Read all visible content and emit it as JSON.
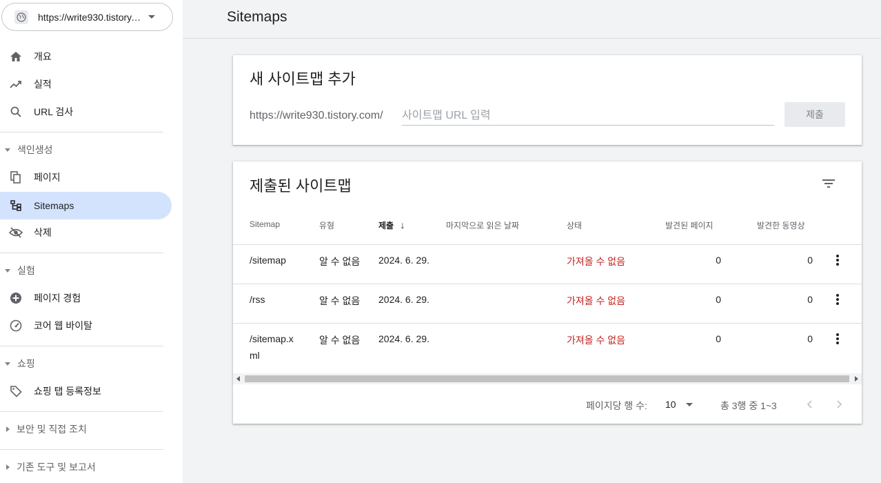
{
  "property": {
    "url": "https://write930.tistory.com/"
  },
  "sidebar": {
    "items": [
      {
        "label": "개요"
      },
      {
        "label": "실적"
      },
      {
        "label": "URL 검사"
      }
    ],
    "sections": [
      {
        "label": "색인생성",
        "items": [
          {
            "label": "페이지"
          },
          {
            "label": "Sitemaps"
          },
          {
            "label": "삭제"
          }
        ]
      },
      {
        "label": "실험",
        "items": [
          {
            "label": "페이지 경험"
          },
          {
            "label": "코어 웹 바이탈"
          }
        ]
      },
      {
        "label": "쇼핑",
        "items": [
          {
            "label": "쇼핑 탭 등록정보"
          }
        ]
      },
      {
        "label": "보안 및 직접 조치"
      },
      {
        "label": "기존 도구 및 보고서"
      }
    ]
  },
  "header": {
    "title": "Sitemaps"
  },
  "add_card": {
    "title": "새 사이트맵 추가",
    "prefix": "https://write930.tistory.com/",
    "placeholder": "사이트맵 URL 입력",
    "value": "",
    "submit_label": "제출"
  },
  "submitted_card": {
    "title": "제출된 사이트맵",
    "columns": [
      "Sitemap",
      "유형",
      "제출",
      "마지막으로 읽은 날짜",
      "상태",
      "발견된 페이지",
      "발견한 동영상"
    ],
    "sort_arrow": "↓",
    "rows": [
      {
        "sitemap": "/sitemap",
        "sitemap2": "",
        "type": "알 수 없음",
        "submitted": "2024. 6. 29.",
        "last_read": "",
        "status": "가져올 수 없음",
        "pages": "0",
        "videos": "0"
      },
      {
        "sitemap": "/rss",
        "sitemap2": "",
        "type": "알 수 없음",
        "submitted": "2024. 6. 29.",
        "last_read": "",
        "status": "가져올 수 없음",
        "pages": "0",
        "videos": "0"
      },
      {
        "sitemap": "/sitemap.x",
        "sitemap2": "ml",
        "type": "알 수 없음",
        "submitted": "2024. 6. 29.",
        "last_read": "",
        "status": "가져올 수 없음",
        "pages": "0",
        "videos": "0"
      }
    ],
    "pager": {
      "rows_per_page_label": "페이지당 행 수:",
      "rows_per_page": "10",
      "range": "총 3행 중 1~3"
    }
  },
  "colors": {
    "active_bg": "#d3e3fd",
    "error": "#c5221f",
    "text": "#202124",
    "muted": "#5f6368"
  }
}
